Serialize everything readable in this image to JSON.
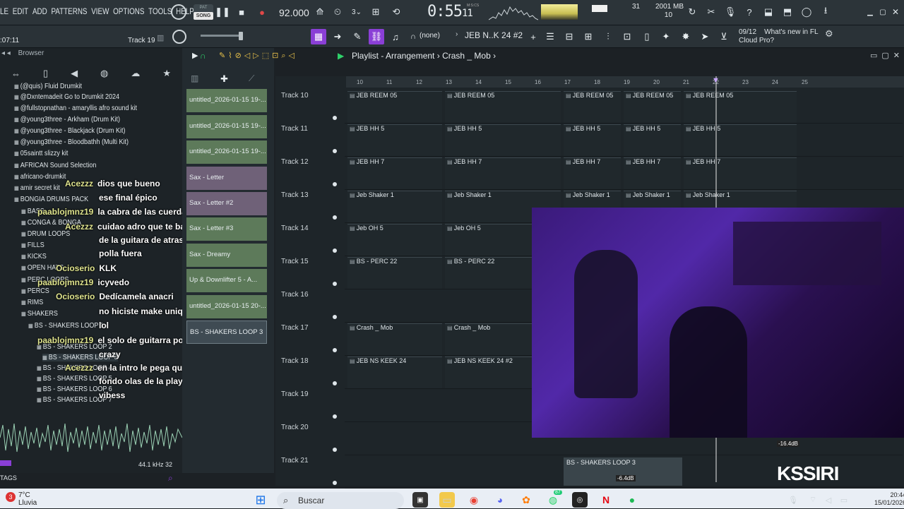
{
  "menu": {
    "items": [
      "LE",
      "EDIT",
      "ADD",
      "PATTERNS",
      "VIEW",
      "OPTIONS",
      "TOOLS",
      "HELP"
    ]
  },
  "transport": {
    "mode_top": "PAT",
    "mode_active": "SONG",
    "tempo": "92.000",
    "time": "0:55",
    "time_small": "11",
    "time_unit": "M:S:CS"
  },
  "perf": {
    "cpu": "31",
    "mem": "2001 MB",
    "poly": "10"
  },
  "toolbar2": {
    "position": ":07:11",
    "track_label": "Track 19",
    "pattern_none": "(none)",
    "pattern": "JEB N..K 24 #2",
    "news_count": "09/12",
    "news_text": "What's new in FL",
    "news_text2": "Cloud Pro?"
  },
  "browser": {
    "title": "Browser",
    "items": [
      "(@quis) Fluid Drumkit",
      "@Dxntemadeit Go to Drumkit 2024",
      "@fullstopnathan - amaryllis afro sound kit",
      "@young3three - Arkham (Drum Kit)",
      "@young3three - Blackjack (Drum Kit)",
      "@young3three - Bloodbathh (Multi Kit)",
      "05saintt slizzy kit",
      "AFRICAN Sound Selection",
      "africano-drumkit",
      "amir secret kit",
      "BONGIA DRUMS PACK",
      "BASS",
      "CONGA & BONGA",
      "DRUM LOOPS",
      "FILLS",
      "KICKS",
      "OPEN HATS",
      "PERC LOOPS",
      "PERCS",
      "RIMS",
      "SHAKERS",
      "BS - SHAKERS LOOP 1",
      "BS - SHAKERS LOOP 2",
      "BS - SHAKERS LOOP 3",
      "BS - SHAKERS LOOP 4",
      "BS - SHAKERS LOOP 5",
      "BS - SHAKERS LOOP 6",
      "BS - SHAKERS LOOP 7"
    ],
    "sample_rate": "44.1 kHz",
    "bits": "32",
    "tags": "TAGS"
  },
  "chat": [
    {
      "user": "Acezzz",
      "msg": "dios que bueno",
      "uc": "u"
    },
    {
      "user": "",
      "msg": "ese final épico",
      "uc": "u"
    },
    {
      "user": "paablojmnz19",
      "msg": "la cabra de las cuerdas",
      "uc": "u"
    },
    {
      "user": "Acezzz",
      "msg": "cuidao adro que te banean que el",
      "uc": "u"
    },
    {
      "user": "",
      "msg": "de la guitara de atras va con la",
      "uc": "u"
    },
    {
      "user": "",
      "msg": "polla fuera",
      "uc": "u"
    },
    {
      "user": "Ocioserio",
      "msg": "KLK",
      "uc": "u"
    },
    {
      "user": "paablojmnz19",
      "msg": "icyvedo",
      "uc": "u"
    },
    {
      "user": "Ocioserio",
      "msg": "Dedícamela anacri",
      "uc": "u"
    },
    {
      "user": "",
      "msg": "no hiciste make unique",
      "uc": "u"
    },
    {
      "user": "",
      "msg": "lol",
      "uc": "u"
    },
    {
      "user": "paablojmnz19",
      "msg": "el solo de guitarra por abajo is",
      "uc": "u"
    },
    {
      "user": "",
      "msg": "crazy",
      "uc": "u"
    },
    {
      "user": "Acezzz",
      "msg": "en la intro le pega que suene de",
      "uc": "u"
    },
    {
      "user": "",
      "msg": "fondo olas de la playa me da esas",
      "uc": "u"
    },
    {
      "user": "",
      "msg": "vibess",
      "uc": "u"
    }
  ],
  "clips_col": [
    "untitled_2026-01-15 19-...",
    "untitled_2026-01-15 19-...",
    "untitled_2026-01-15 19-...",
    "Sax - Letter",
    "Sax - Letter #2",
    "Sax - Letter #3",
    "Sax - Dreamy",
    "Up & Downlifter 5 - A...",
    "untitled_2026-01-15 20-...",
    "BS - SHAKERS LOOP 3"
  ],
  "playlist": {
    "title": "Playlist - Arrangement",
    "pattern": "Crash _ Mob",
    "ruler": [
      "10",
      "11",
      "12",
      "13",
      "14",
      "15",
      "16",
      "17",
      "18",
      "19",
      "20",
      "21",
      "22",
      "23",
      "24",
      "25"
    ],
    "tracks": [
      {
        "name": "Track 10",
        "clips": [
          "JEB REEM 05",
          "JEB REEM 05",
          "JEB REEM 05",
          "JEB REEM 05",
          "JEB REEM 05"
        ]
      },
      {
        "name": "Track 11",
        "clips": [
          "JEB HH 5",
          "JEB HH 5",
          "JEB HH 5",
          "JEB HH 5",
          "JEB HH 5"
        ]
      },
      {
        "name": "Track 12",
        "clips": [
          "JEB HH 7",
          "JEB HH 7",
          "JEB HH 7",
          "JEB HH 7",
          "JEB HH 7"
        ]
      },
      {
        "name": "Track 13",
        "clips": [
          "Jeb Shaker 1",
          "Jeb Shaker 1",
          "Jeb Shaker 1",
          "Jeb Shaker 1",
          "Jeb Shaker 1"
        ]
      },
      {
        "name": "Track 14",
        "clips": [
          "Jeb OH 5",
          "Jeb OH 5"
        ]
      },
      {
        "name": "Track 15",
        "clips": [
          "BS - PERC 22",
          "BS - PERC 22"
        ]
      },
      {
        "name": "Track 16",
        "clips": []
      },
      {
        "name": "Track 17",
        "clips": [
          "Crash _ Mob",
          "Crash _ Mob"
        ]
      },
      {
        "name": "Track 18",
        "clips": [
          "JEB NS KEEK 24",
          "JEB NS KEEK 24 #2"
        ]
      },
      {
        "name": "Track 19",
        "clips": []
      },
      {
        "name": "Track 20",
        "clips": []
      },
      {
        "name": "Track 21",
        "clips": []
      }
    ],
    "bottom_clip": "BS - SHAKERS LOOP 3",
    "db1": "-16.4dB",
    "db2": "-6.4dB"
  },
  "watermark": "KSSIRI",
  "taskbar": {
    "temp": "7°C",
    "weather": "Lluvia",
    "search": "Buscar",
    "time": "20:44",
    "date": "15/01/2026",
    "badge": "3",
    "badge2": "87"
  },
  "colors": {
    "accent": "#8a3fd6",
    "clip_green": "#5d7a5a",
    "clip_sax": "#6f6178"
  }
}
